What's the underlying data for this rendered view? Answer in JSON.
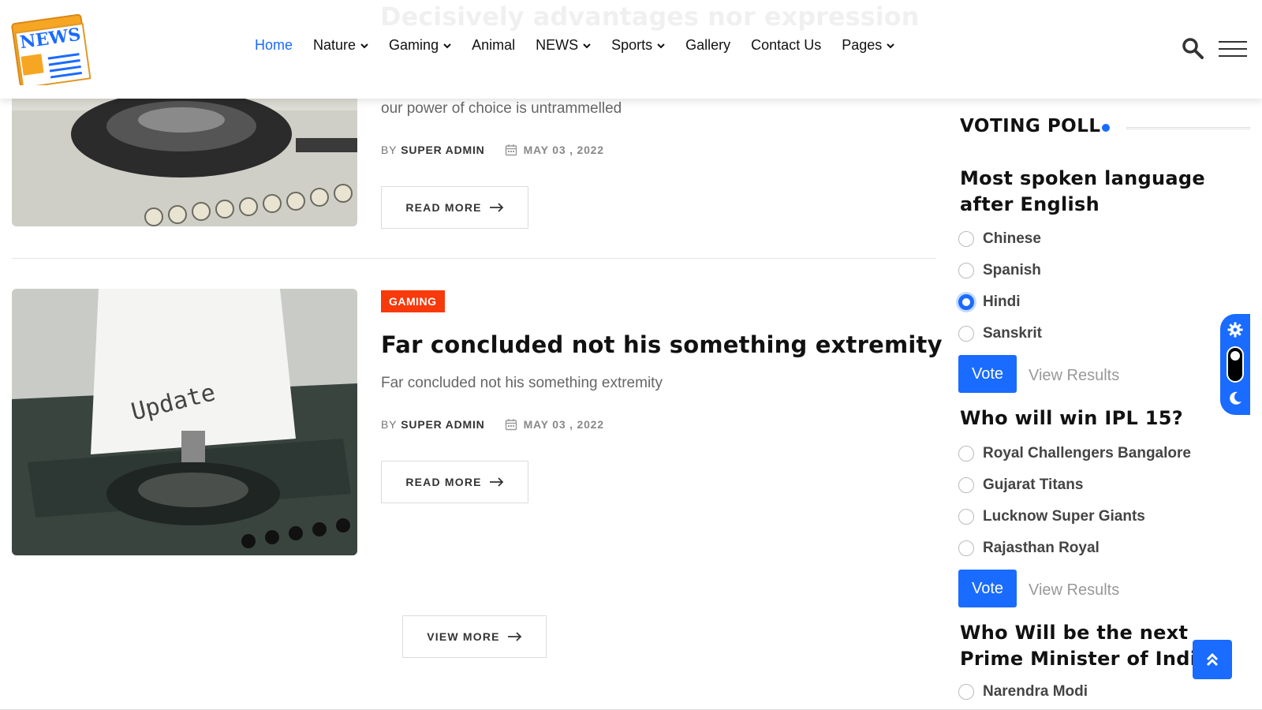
{
  "header": {
    "logo_text": "NEWS",
    "nav": [
      {
        "label": "Home",
        "active": true,
        "dropdown": false
      },
      {
        "label": "Nature",
        "active": false,
        "dropdown": true
      },
      {
        "label": "Gaming",
        "active": false,
        "dropdown": true
      },
      {
        "label": "Animal",
        "active": false,
        "dropdown": false
      },
      {
        "label": "NEWS",
        "active": false,
        "dropdown": true
      },
      {
        "label": "Sports",
        "active": false,
        "dropdown": true
      },
      {
        "label": "Gallery",
        "active": false,
        "dropdown": false
      },
      {
        "label": "Contact Us",
        "active": false,
        "dropdown": false
      },
      {
        "label": "Pages",
        "active": false,
        "dropdown": true
      }
    ],
    "faded_title": "Decisively advantages nor expression"
  },
  "articles": [
    {
      "excerpt": "our power of choice is untrammelled",
      "by": "BY",
      "author": "SUPER ADMIN",
      "date": "MAY 03 , 2022",
      "read_more": "READ MORE"
    },
    {
      "category": "GAMING",
      "title": "Far concluded not his something extremity",
      "excerpt": "Far concluded not his something extremity",
      "by": "BY",
      "author": "SUPER ADMIN",
      "date": "MAY 03 , 2022",
      "read_more": "READ MORE",
      "image_text": "Update"
    }
  ],
  "view_more": "VIEW MORE",
  "poll": {
    "heading": "VOTING POLL",
    "questions": [
      {
        "question": "Most spoken language after English",
        "options": [
          "Chinese",
          "Spanish",
          "Hindi",
          "Sanskrit"
        ],
        "selected": "Hindi",
        "vote": "Vote",
        "view_results": "View Results"
      },
      {
        "question": "Who will win IPL 15?",
        "options": [
          "Royal Challengers Bangalore",
          "Gujarat Titans",
          "Lucknow Super Giants",
          "Rajasthan Royal"
        ],
        "vote": "Vote",
        "view_results": "View Results"
      },
      {
        "question": "Who Will be the next Prime Minister of India",
        "options": [
          "Narendra Modi"
        ]
      }
    ]
  },
  "colors": {
    "accent": "#1a6bff",
    "badge": "#f8390a"
  }
}
